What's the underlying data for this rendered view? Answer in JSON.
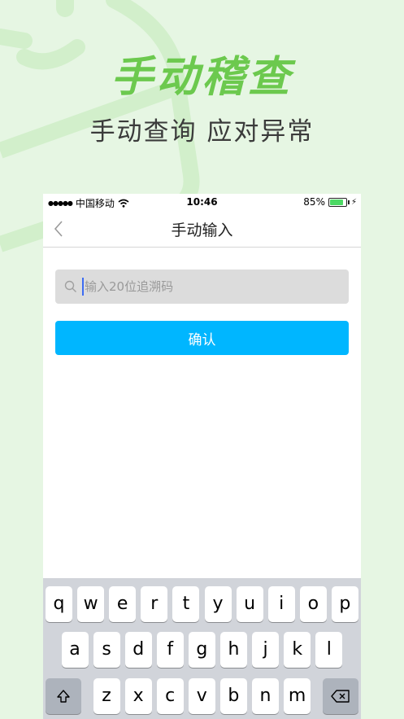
{
  "hero": {
    "title": "手动稽查",
    "subtitle": "手动查询  应对异常"
  },
  "status_bar": {
    "signal": "●●●●●",
    "carrier": "中国移动",
    "time": "10:46",
    "battery_text": "85%",
    "battery_level": 0.85
  },
  "nav": {
    "title": "手动输入",
    "back_icon": "chevron-left-icon"
  },
  "search": {
    "placeholder": "输入20位追溯码",
    "value": "",
    "icon": "search-icon"
  },
  "confirm_label": "确认",
  "keyboard": {
    "row1": [
      "q",
      "w",
      "e",
      "r",
      "t",
      "y",
      "u",
      "i",
      "o",
      "p"
    ],
    "row2": [
      "a",
      "s",
      "d",
      "f",
      "g",
      "h",
      "j",
      "k",
      "l"
    ],
    "row3": [
      "z",
      "x",
      "c",
      "v",
      "b",
      "n",
      "m"
    ],
    "shift_icon": "shift-icon",
    "delete_icon": "backspace-icon"
  },
  "colors": {
    "accent": "#6cc94e",
    "button": "#00b6ff",
    "background": "#e6f6e3"
  }
}
